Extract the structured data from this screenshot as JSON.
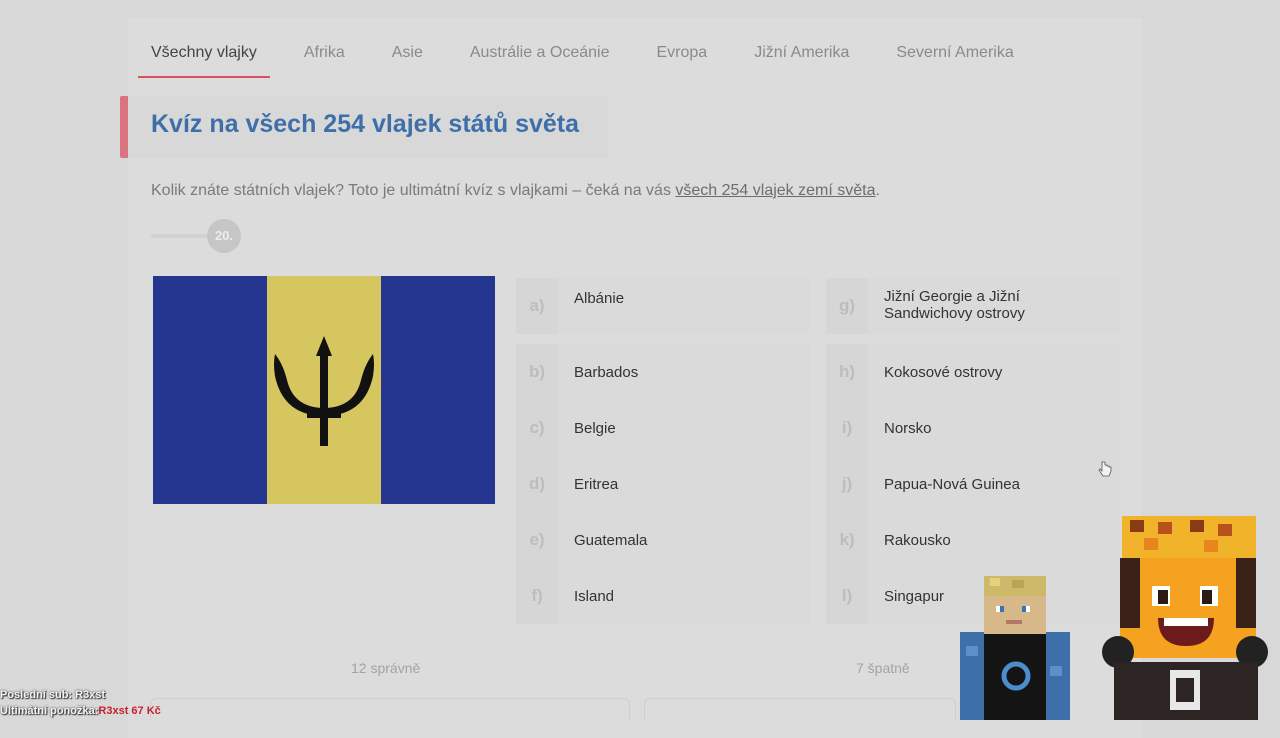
{
  "tabs": [
    "Všechny vlajky",
    "Afrika",
    "Asie",
    "Austrálie a Oceánie",
    "Evropa",
    "Jižní Amerika",
    "Severní Amerika"
  ],
  "title": "Kvíz na všech 254 vlajek států světa",
  "intro": {
    "text": "Kolik znáte státních vlajek? Toto je ultimátní kvíz s vlajkami – čeká na vás ",
    "link": "všech 254 vlajek zemí světa",
    "end": "."
  },
  "progress": {
    "number": "20."
  },
  "flag": {
    "name": "Barbados flag",
    "colors": {
      "blue": "#24368f",
      "gold": "#d6c65f",
      "black": "#111111"
    }
  },
  "options": [
    {
      "letter": "a)",
      "label": "Albánie"
    },
    {
      "letter": "b)",
      "label": "Barbados"
    },
    {
      "letter": "c)",
      "label": "Belgie"
    },
    {
      "letter": "d)",
      "label": "Eritrea"
    },
    {
      "letter": "e)",
      "label": "Guatemala"
    },
    {
      "letter": "f)",
      "label": "Island"
    },
    {
      "letter": "g)",
      "label": "Jižní Georgie a Jižní Sandwichovy ostrovy"
    },
    {
      "letter": "h)",
      "label": "Kokosové ostrovy"
    },
    {
      "letter": "i)",
      "label": "Norsko"
    },
    {
      "letter": "j)",
      "label": "Papua-Nová Guinea"
    },
    {
      "letter": "k)",
      "label": "Rakousko"
    },
    {
      "letter": "l)",
      "label": "Singapur"
    }
  ],
  "score": {
    "correct": "12 správně",
    "wrong": "7 špatně"
  },
  "stream_overlay": {
    "last_sub": "Poslední sub: R3xst",
    "sock_label": "Ultimátní ponožka:",
    "sock_value": "R3xst 67 Kč"
  },
  "accent_color": "#d9505f",
  "title_color": "#3e6fa8"
}
